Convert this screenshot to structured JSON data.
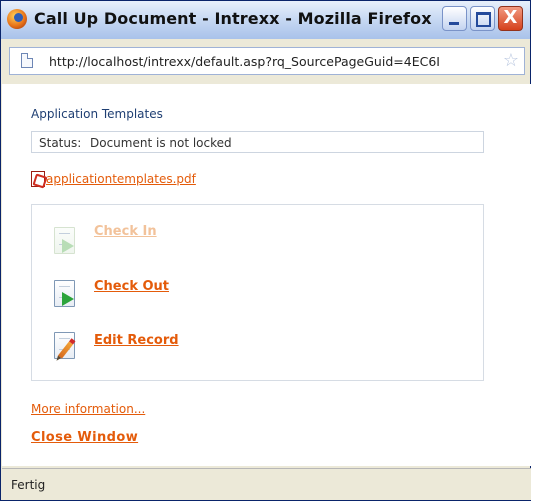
{
  "window": {
    "title": "Call Up Document - Intrexx - Mozilla Firefox",
    "close_glyph": "X"
  },
  "address_bar": {
    "url": "http://localhost/intrexx/default.asp?rq_SourcePageGuid=4EC6I"
  },
  "page": {
    "app_title": "Application Templates",
    "status": {
      "label": "Status:",
      "value": "Document is not locked"
    },
    "file_link": "applicationtemplates.pdf",
    "actions": [
      {
        "label": "Check In",
        "enabled": false,
        "icon": "check-in-icon"
      },
      {
        "label": "Check Out",
        "enabled": true,
        "icon": "check-out-icon"
      },
      {
        "label": "Edit Record",
        "enabled": true,
        "icon": "edit-record-icon"
      }
    ],
    "more_info": "More information...",
    "close_window": "Close Window"
  },
  "status_bar": {
    "text": "Fertig"
  },
  "colors": {
    "link": "#e45b0a",
    "disabled_link": "#f2c29a",
    "heading": "#1f3f73"
  }
}
